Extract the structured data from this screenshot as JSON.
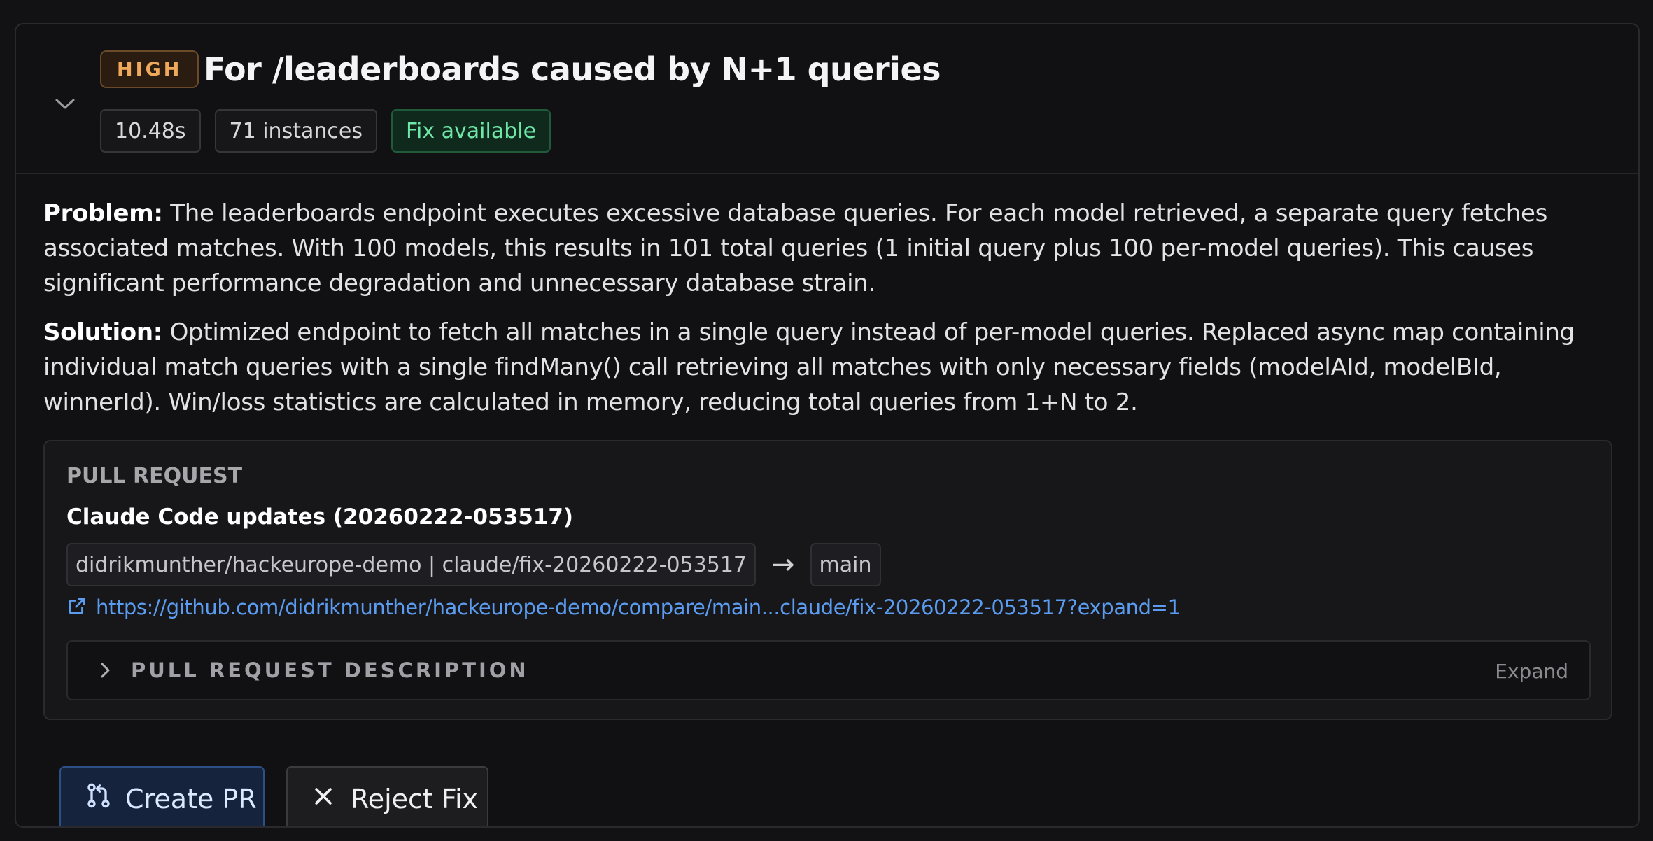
{
  "issue": {
    "severity": "HIGH",
    "title": "For /leaderboards caused by N+1 queries",
    "duration": "10.48s",
    "instances": "71 instances",
    "fix_status": "Fix available"
  },
  "problem": {
    "label": "Problem:",
    "text": "The leaderboards endpoint executes excessive database queries. For each model retrieved, a separate query fetches associated matches. With 100 models, this results in 101 total queries (1 initial query plus 100 per-model queries). This causes significant performance degradation and unnecessary database strain."
  },
  "solution": {
    "label": "Solution:",
    "text": "Optimized endpoint to fetch all matches in a single query instead of per-model queries. Replaced async map containing individual match queries with a single findMany() call retrieving all matches with only necessary fields (modelAId, modelBId, winnerId). Win/loss statistics are calculated in memory, reducing total queries from 1+N to 2."
  },
  "pull_request": {
    "heading": "PULL REQUEST",
    "title": "Claude Code updates (20260222-053517)",
    "source_branch": "didrikmunther/hackeurope-demo | claude/fix-20260222-053517",
    "arrow": "→",
    "target_branch": "main",
    "url": "https://github.com/didrikmunther/hackeurope-demo/compare/main...claude/fix-20260222-053517?expand=1",
    "description_label": "PULL REQUEST DESCRIPTION",
    "expand_label": "Expand"
  },
  "actions": {
    "create_label": "Create PR",
    "reject_label": "Reject Fix"
  },
  "icons": {
    "collapse": "chevron-down-icon",
    "external_link": "external-link-icon",
    "description_toggle": "chevron-right-icon",
    "create": "git-pull-request-icon",
    "reject": "close-icon"
  },
  "colors": {
    "severity": "#f0a95a",
    "fix_available": "#6ee7a8",
    "link": "#5b9cf0",
    "primary_button": "#2c4f86"
  }
}
